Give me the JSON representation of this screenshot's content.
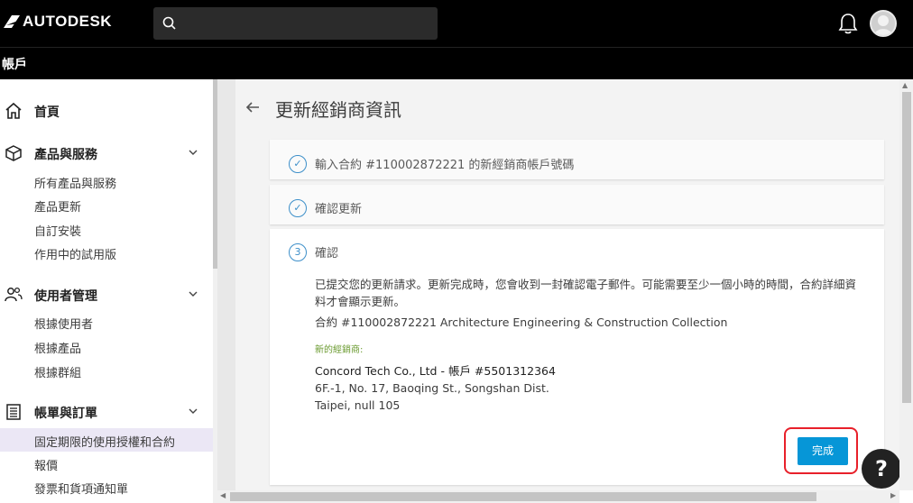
{
  "header": {
    "brand": "AUTODESK",
    "search_placeholder": "",
    "account_label": "帳戶"
  },
  "sidebar": {
    "sections": [
      {
        "label": "首頁",
        "icon": "home-icon"
      },
      {
        "label": "產品與服務",
        "icon": "box-icon",
        "items": [
          "所有產品與服務",
          "產品更新",
          "自訂安裝",
          "作用中的試用版"
        ]
      },
      {
        "label": "使用者管理",
        "icon": "users-icon",
        "items": [
          "根據使用者",
          "根據產品",
          "根據群組"
        ]
      },
      {
        "label": "帳單與訂單",
        "icon": "billing-icon",
        "items": [
          "固定期限的使用授權和合約",
          "報價",
          "發票和貨項通知單"
        ]
      }
    ],
    "active_item": "固定期限的使用授權和合約"
  },
  "main": {
    "title": "更新經銷商資訊",
    "steps": [
      {
        "marker": "✓",
        "label": "輸入合約 #110002872221 的新經銷商帳戶號碼"
      },
      {
        "marker": "✓",
        "label": "確認更新"
      },
      {
        "marker": "3",
        "label": "確認"
      }
    ],
    "confirmation": {
      "message_line1": "已提交您的更新請求。更新完成時，您會收到一封確認電子郵件。可能需要至少一個小時的時間，合約詳細資",
      "message_line2": "料才會顯示更新。",
      "contract_prefix": "合約 ",
      "contract_number": "#110002872221",
      "contract_product": " Architecture Engineering & Construction Collection",
      "new_reseller_label": "新的經銷商:",
      "reseller_name": "Concord Tech Co., Ltd - 帳戶 #5501312364",
      "address_line1": "6F.-1, No. 17, Baoqing St., Songshan Dist.",
      "address_line2": "Taipei, null 105"
    },
    "done_label": "完成"
  },
  "help_label": "?",
  "colors": {
    "accent": "#0696d7",
    "step_icon": "#3d8fc9",
    "highlight": "#e8202a",
    "hint": "#6a9a2f"
  }
}
